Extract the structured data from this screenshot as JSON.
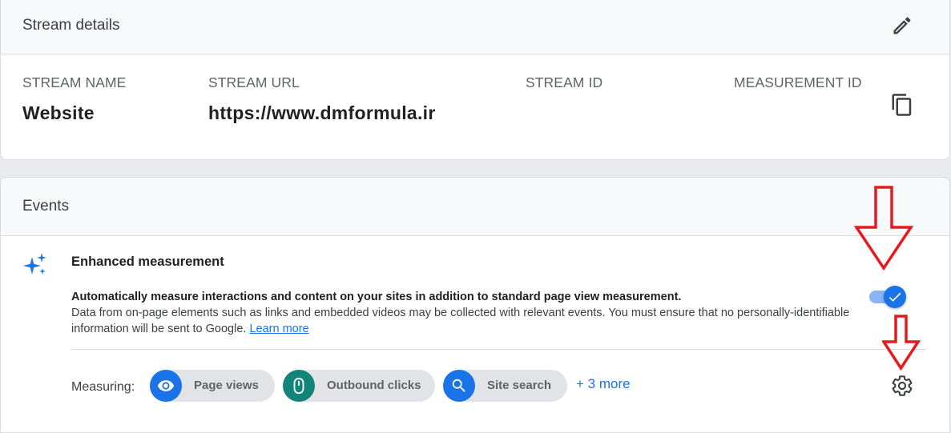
{
  "stream_details": {
    "title": "Stream details",
    "columns": [
      {
        "label": "STREAM NAME",
        "value": "Website"
      },
      {
        "label": "STREAM URL",
        "value": "https://www.dmformula.ir"
      },
      {
        "label": "STREAM ID",
        "value": ""
      },
      {
        "label": "MEASUREMENT ID",
        "value": ""
      }
    ],
    "edit_icon": "pencil-icon",
    "copy_icon": "copy-icon"
  },
  "events": {
    "title": "Events",
    "enhanced_measurement": {
      "icon": "sparkle-icon",
      "title": "Enhanced measurement",
      "desc_bold": "Automatically measure interactions and content on your sites in addition to standard page view measurement.",
      "desc_text": "Data from on-page elements such as links and embedded videos may be collected with relevant events. You must ensure that no personally-identifiable information will be sent to Google.",
      "learn_more": "Learn more",
      "enabled": true
    },
    "measuring": {
      "label": "Measuring:",
      "chips": [
        {
          "label": "Page views",
          "icon": "eye-icon",
          "color": "#1a73e8"
        },
        {
          "label": "Outbound clicks",
          "icon": "mouse-icon",
          "color": "#12857a"
        },
        {
          "label": "Site search",
          "icon": "search-icon",
          "color": "#1a73e8"
        }
      ],
      "more": "+ 3 more",
      "settings_icon": "gear-icon"
    }
  },
  "colors": {
    "accent": "#1a73e8",
    "teal": "#12857a",
    "annotation_arrow": "#e8191c"
  }
}
